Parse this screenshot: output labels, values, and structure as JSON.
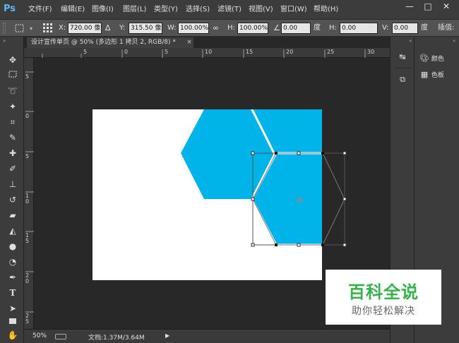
{
  "app": {
    "logo": "Ps"
  },
  "menu": [
    "文件(F)",
    "编辑(E)",
    "图像(I)",
    "图层(L)",
    "类型(Y)",
    "选择(S)",
    "滤镜(T)",
    "视图(V)",
    "窗口(W)",
    "帮助(H)"
  ],
  "window_controls": {
    "minimize": "—",
    "restore": "□",
    "close": "✕"
  },
  "options": {
    "x_label": "X:",
    "x_value": "720.00 像",
    "y_label": "Y:",
    "y_value": "315.50 像",
    "w_label": "W:",
    "w_value": "100.00%",
    "h_label": "H:",
    "h_value": "100.00%",
    "angle_value": "0.00",
    "angle_unit": "度",
    "hskew_label": "H:",
    "hskew_value": "0.00",
    "hskew_unit": "度",
    "vskew_label": "V:",
    "vskew_value": "0.00",
    "vskew_unit": "度",
    "interp_label": "插值:"
  },
  "document": {
    "tab_title": "设计宣传单页 @ 50% (多边形 1 拷贝 2, RGB/8) *",
    "tab_close": "×"
  },
  "rulers": {
    "top": [
      "5",
      "0",
      "5",
      "10",
      "15",
      "20",
      "25",
      "30"
    ],
    "left": [
      "5",
      "0",
      "5",
      "1 0",
      "1 5",
      "2 0",
      "2 5"
    ]
  },
  "status": {
    "zoom": "50%",
    "doc_info": "文档:1.37M/3.64M"
  },
  "panels": [
    {
      "icon": "palette-icon",
      "label": "颜色"
    },
    {
      "icon": "swatches-icon",
      "label": "色板"
    }
  ],
  "colors": {
    "shape_fill": "#00b4ea",
    "canvas": "#ffffff",
    "watermark_green": "#36b24a"
  },
  "watermark": {
    "title": "百科全说",
    "subtitle": "助你轻松解决"
  }
}
